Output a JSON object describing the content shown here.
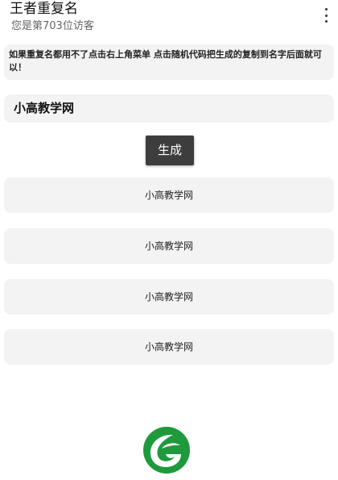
{
  "header": {
    "title": "王者重复名",
    "visitor_text": "您是第703位访客",
    "menu_icon": "more-vert-icon"
  },
  "notice": {
    "text": "如果重复名都用不了点击右上角菜单 点击随机代码把生成的复制到名字后面就可以！"
  },
  "input": {
    "value": "小高教学网"
  },
  "generate_button": {
    "label": "生成"
  },
  "results": [
    {
      "text": "小高教学网"
    },
    {
      "text": "小高教学网"
    },
    {
      "text": "小高教学网"
    },
    {
      "text": "小高教学网"
    }
  ],
  "logo": {
    "icon": "leaf-logo-icon",
    "color": "#1e9a3c"
  }
}
